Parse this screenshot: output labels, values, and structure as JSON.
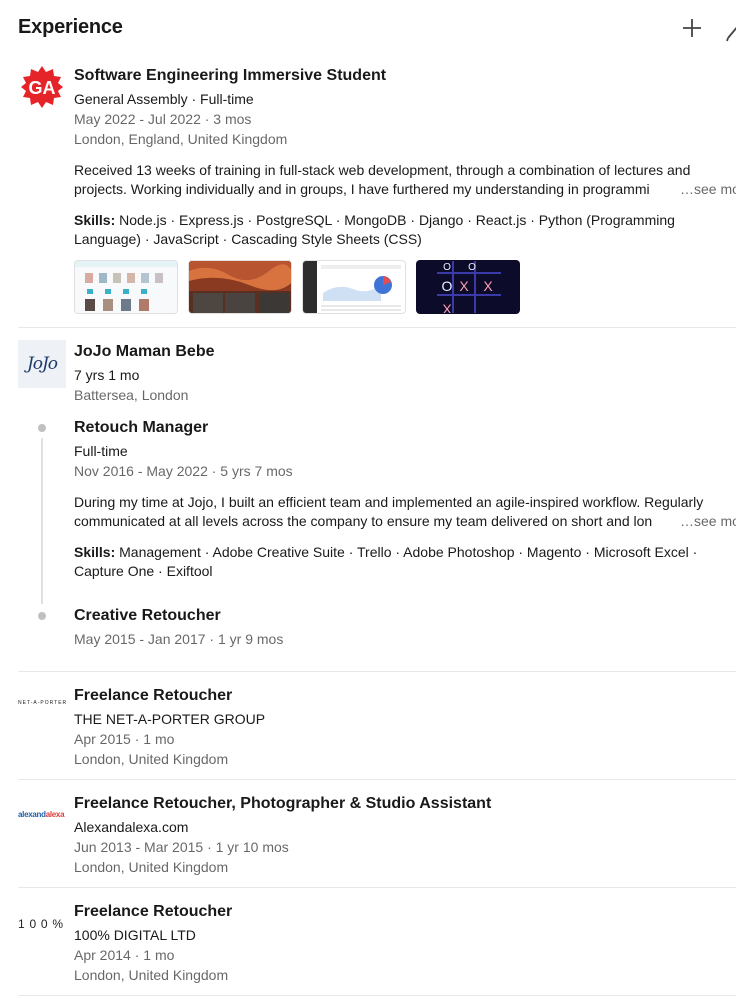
{
  "header": {
    "title": "Experience",
    "add_icon": "plus-icon",
    "edit_icon": "pencil-icon"
  },
  "entries": [
    {
      "logo_text": "GA",
      "logo_color": "#e5242a",
      "title": "Software Engineering Immersive Student",
      "company": "General Assembly · Full-time",
      "dates": "May 2022 - Jul 2022 · 3 mos",
      "location": "London, England, United Kingdom",
      "description_line1": "Received 13 weeks of training in full-stack web development, through a combination of lectures and",
      "description_line2": "projects. Working individually and in groups, I have furthered my understanding in programmi",
      "see_more": "…see more",
      "skills_label": "Skills:",
      "skills_line1": "Node.js · Express.js · PostgreSQL · MongoDB · Django · React.js · Python (Programming",
      "skills_line2": "Language) · JavaScript · Cascading Style Sheets (CSS)"
    },
    {
      "logo_text": "JoJo",
      "title": "JoJo Maman Bebe",
      "duration": "7 yrs 1 mo",
      "location": "Battersea, London",
      "roles": [
        {
          "title": "Retouch Manager",
          "type": "Full-time",
          "dates": "Nov 2016 - May 2022 · 5 yrs 7 mos",
          "description_line1": "During my time at Jojo, I built an efficient team and implemented an agile-inspired workflow. Regularly",
          "description_line2": "communicated at all levels across the company to ensure my team delivered on short and lon",
          "see_more": "…see more",
          "skills_label": "Skills:",
          "skills_line1": "Management · Adobe Creative Suite · Trello · Adobe Photoshop · Magento · Microsoft Excel ·",
          "skills_line2": "Capture One · Exiftool"
        },
        {
          "title": "Creative Retoucher",
          "dates": "May 2015 - Jan 2017 · 1 yr 9 mos"
        }
      ]
    },
    {
      "logo_text": "NET-A-PORTER",
      "title": "Freelance Retoucher",
      "company": "THE NET-A-PORTER GROUP",
      "dates": "Apr 2015 · 1 mo",
      "location": "London, United Kingdom"
    },
    {
      "logo_text_a": "alexand",
      "logo_text_b": "alexa",
      "title": "Freelance Retoucher, Photographer & Studio Assistant",
      "company": "Alexandalexa.com",
      "dates": "Jun 2013 - Mar 2015 · 1 yr 10 mos",
      "location": "London, United Kingdom"
    },
    {
      "logo_text": "100%",
      "title": "Freelance Retoucher",
      "company": "100% DIGITAL LTD",
      "dates": "Apr 2014 · 1 mo",
      "location": "London, United Kingdom"
    }
  ],
  "colors": {
    "muted": "#666666",
    "divider": "#e8e8e8",
    "ga_red": "#e5242a",
    "jojo_navy": "#1d3a6b"
  }
}
